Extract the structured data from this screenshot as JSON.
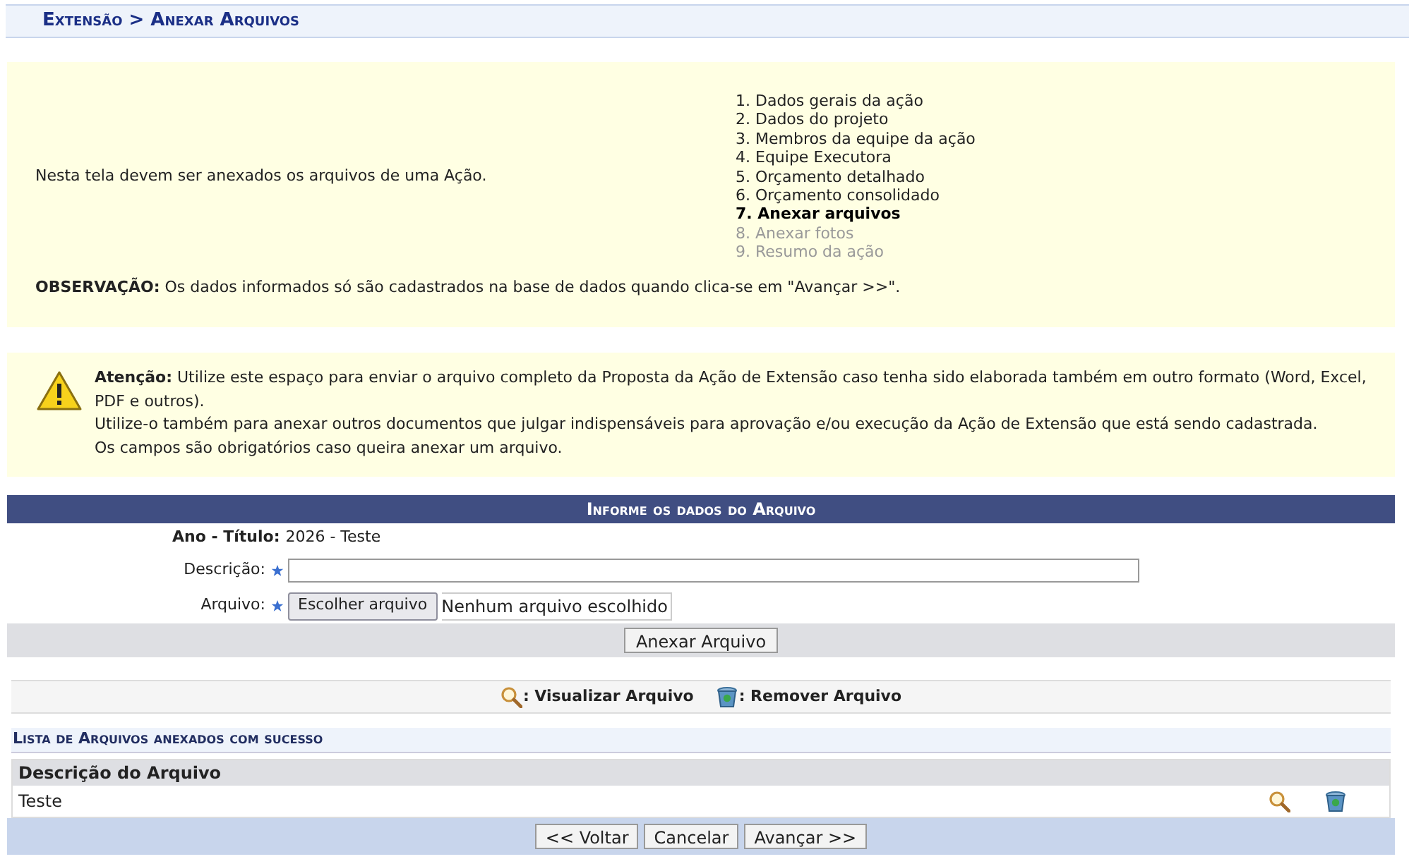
{
  "breadcrumb": "Extensão > Anexar Arquivos",
  "intro": {
    "text": "Nesta tela devem ser anexados os arquivos de uma Ação.",
    "steps": [
      {
        "label": "1. Dados gerais da ação",
        "selected": false,
        "disabled": false
      },
      {
        "label": "2. Dados do projeto",
        "selected": false,
        "disabled": false
      },
      {
        "label": "3. Membros da equipe da ação",
        "selected": false,
        "disabled": false
      },
      {
        "label": "4. Equipe Executora",
        "selected": false,
        "disabled": false
      },
      {
        "label": "5. Orçamento detalhado",
        "selected": false,
        "disabled": false
      },
      {
        "label": "6. Orçamento consolidado",
        "selected": false,
        "disabled": false
      },
      {
        "label": "7. Anexar arquivos",
        "selected": true,
        "disabled": false
      },
      {
        "label": "8. Anexar fotos",
        "selected": false,
        "disabled": true
      },
      {
        "label": "9. Resumo da ação",
        "selected": false,
        "disabled": true
      }
    ],
    "note": "**OBSERVAÇÃO:** Os dados informados só são cadastrados na base de dados quando clica-se em \"Avançar >>\"."
  },
  "warning": {
    "lines": [
      "**Atenção:** Utilize este espaço para enviar o arquivo completo da Proposta da Ação de Extensão caso tenha sido elaborada também em outro formato (Word, Excel, PDF e outros).",
      "Utilize-o também para anexar outros documentos que julgar indispensáveis para aprovação e/ou execução da Ação de Extensão que está sendo cadastrada.",
      "Os campos são obrigatórios caso queira anexar um arquivo."
    ]
  },
  "form": {
    "title": "Informe os dados do Arquivo",
    "ano_label": "Ano - Título:",
    "ano_value": "2026 - Teste",
    "descricao_label": "Descrição:",
    "arquivo_label": "Arquivo:",
    "choose_button": "Escolher arquivo",
    "no_file": "Nenhum arquivo escolhido",
    "submit": "Anexar Arquivo"
  },
  "legend": {
    "view": ": Visualizar Arquivo",
    "remove": ": Remover Arquivo"
  },
  "list": {
    "title": "Lista de Arquivos anexados com sucesso",
    "column": "Descrição do Arquivo",
    "rows": [
      {
        "description": "Teste"
      }
    ]
  },
  "buttons": [
    "<< Voltar",
    "Cancelar",
    "Avançar >>"
  ]
}
